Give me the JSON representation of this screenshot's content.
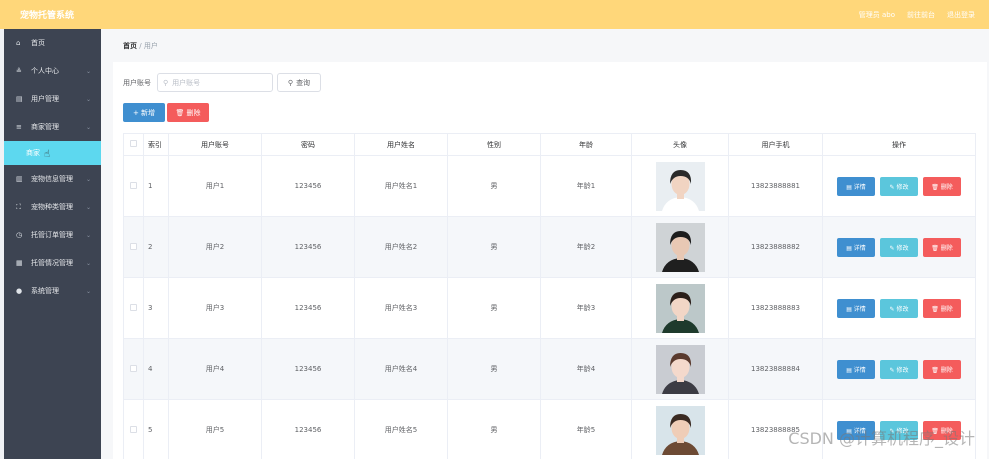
{
  "header": {
    "title": "宠物托管系统",
    "links": [
      "管理员 abo",
      "前往前台",
      "退出登录"
    ]
  },
  "sidebar": {
    "items": [
      {
        "label": "首页",
        "icon": "home-icon",
        "glyph": "⌂",
        "chevron": false
      },
      {
        "label": "个人中心",
        "icon": "user-icon",
        "glyph": "≗",
        "chevron": true
      },
      {
        "label": "用户管理",
        "icon": "list-icon",
        "glyph": "▤",
        "chevron": true
      },
      {
        "label": "商家管理",
        "icon": "menu-icon",
        "glyph": "≡",
        "chevron": true
      },
      {
        "label": "宠物信息管理",
        "icon": "chart-icon",
        "glyph": "▥",
        "chevron": true
      },
      {
        "label": "宠物种类管理",
        "icon": "scan-icon",
        "glyph": "⛶",
        "chevron": true
      },
      {
        "label": "托管订单管理",
        "icon": "clock-icon",
        "glyph": "◷",
        "chevron": true
      },
      {
        "label": "托管情况管理",
        "icon": "doc-icon",
        "glyph": "▦",
        "chevron": true
      },
      {
        "label": "系统管理",
        "icon": "pin-icon",
        "glyph": "●",
        "chevron": true
      }
    ],
    "active_sub": "商家"
  },
  "breadcrumb": {
    "home": "首页",
    "sep": "/",
    "current": "用户"
  },
  "search": {
    "label": "用户账号",
    "placeholder": "用户账号",
    "button": "查询"
  },
  "actions": {
    "add": "+ 新增",
    "delete": "🗑 删除"
  },
  "table": {
    "columns": [
      "索引",
      "用户账号",
      "密码",
      "用户姓名",
      "性别",
      "年龄",
      "头像",
      "用户手机",
      "操作"
    ],
    "rows": [
      {
        "index": "1",
        "account": "用户1",
        "password": "123456",
        "name": "用户姓名1",
        "gender": "男",
        "age": "年龄1",
        "phone": "13823888881"
      },
      {
        "index": "2",
        "account": "用户2",
        "password": "123456",
        "name": "用户姓名2",
        "gender": "男",
        "age": "年龄2",
        "phone": "13823888882"
      },
      {
        "index": "3",
        "account": "用户3",
        "password": "123456",
        "name": "用户姓名3",
        "gender": "男",
        "age": "年龄3",
        "phone": "13823888883"
      },
      {
        "index": "4",
        "account": "用户4",
        "password": "123456",
        "name": "用户姓名4",
        "gender": "男",
        "age": "年龄4",
        "phone": "13823888884"
      },
      {
        "index": "5",
        "account": "用户5",
        "password": "123456",
        "name": "用户姓名5",
        "gender": "男",
        "age": "年龄5",
        "phone": "13823888885"
      }
    ],
    "ops": {
      "detail": "▤ 详情",
      "edit": "✎ 修改",
      "remove": "🗑 删除"
    }
  },
  "watermark": "CSDN @计算机程序_设计"
}
